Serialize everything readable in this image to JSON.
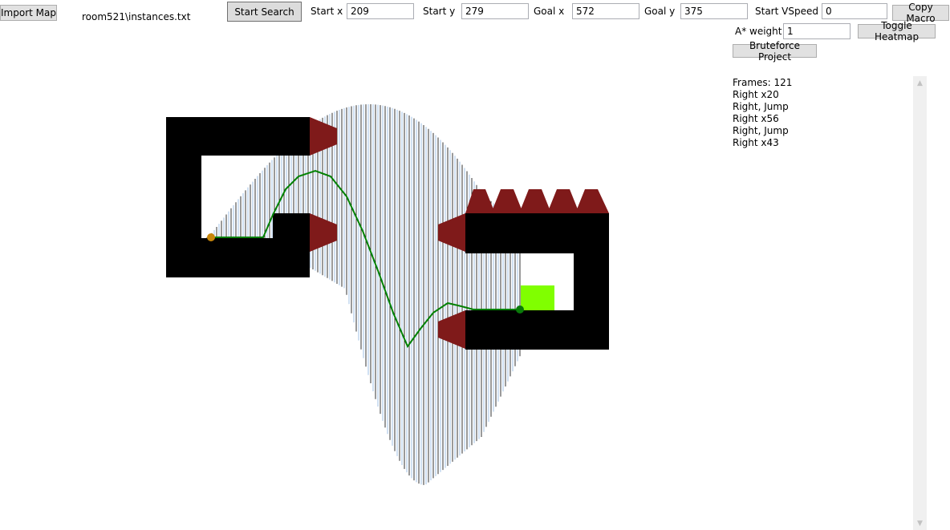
{
  "toolbar": {
    "import_label": "Import Map",
    "map_path": "room521\\instances.txt",
    "start_search_label": "Start Search",
    "start_x_label": "Start x",
    "start_x_value": "209",
    "start_y_label": "Start y",
    "start_y_value": "279",
    "goal_x_label": "Goal x",
    "goal_x_value": "572",
    "goal_y_label": "Goal y",
    "goal_y_value": "375",
    "start_vspeed_label": "Start VSpeed",
    "start_vspeed_value": "0",
    "copy_macro_label": "Copy Macro",
    "astar_weight_label": "A* weight",
    "astar_weight_value": "1",
    "toggle_heatmap_label": "Toggle Heatmap",
    "bruteforce_label": "Bruteforce Project"
  },
  "macro": {
    "lines": [
      "Frames: 121",
      "Right x20",
      "Right, Jump",
      "Right x56",
      "Right, Jump",
      "Right x43"
    ]
  },
  "colors": {
    "wall": "#000000",
    "spike": "#7f1a1a",
    "path": "#008000",
    "start_marker": "#c8860a",
    "goal_marker": "#0a7a0a",
    "goal_block": "#80ff00"
  },
  "icons": {
    "scroll_up": "chevron-up-icon",
    "scroll_down": "chevron-down-icon"
  }
}
